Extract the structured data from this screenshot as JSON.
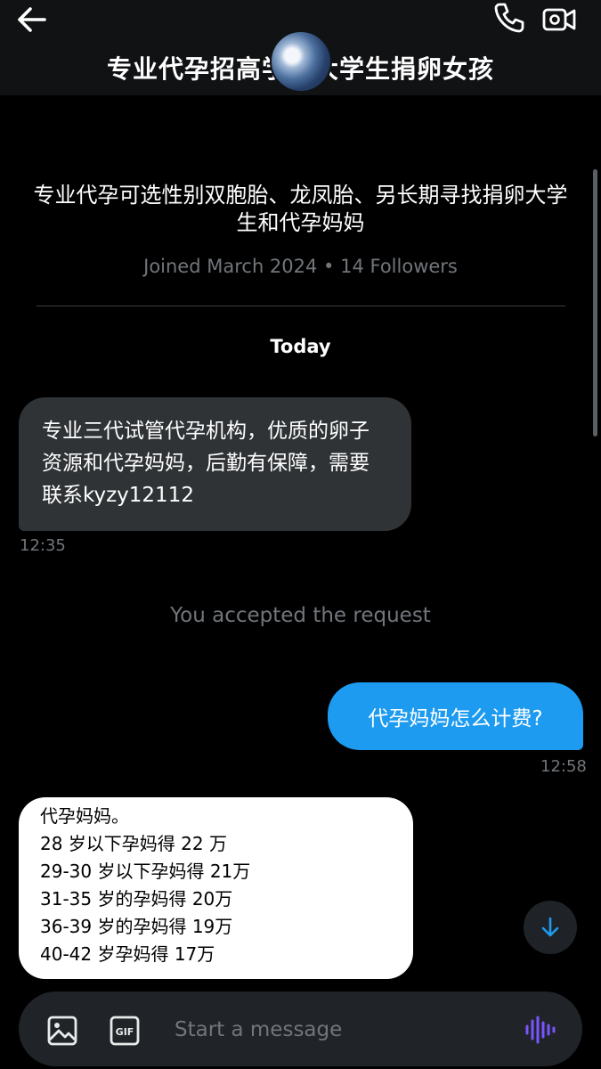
{
  "header": {
    "title": "专业代孕招高学历大学生捐卵女孩"
  },
  "profile": {
    "bio": "专业代孕可选性别双胞胎、龙凤胎、另长期寻找捐卵大学生和代孕妈妈",
    "meta": "Joined March 2024 • 14 Followers"
  },
  "conversation": {
    "day_label": "Today",
    "messages": [
      {
        "text": "专业三代试管代孕机构，优质的卵子资源和代孕妈妈，后勤有保障，需要联系kyzy12112",
        "time": "12:35"
      },
      {
        "system": "You accepted the request"
      },
      {
        "text": "代孕妈妈怎么计费?",
        "time": "12:58"
      }
    ],
    "image_message": {
      "lines": [
        "代孕妈妈。",
        "28 岁以下孕妈得 22 万",
        "29-30 岁以下孕妈得 21万",
        "31-35 岁的孕妈得 20万",
        "36-39 岁的孕妈得 19万",
        "40-42 岁孕妈得 17万"
      ]
    }
  },
  "composer": {
    "placeholder": "Start a message",
    "gif_label": "GIF"
  },
  "colors": {
    "accent": "#1d9bf0",
    "incoming_bubble": "#2f3336",
    "muted_text": "#71767b",
    "voice_icon": "#7856ff"
  },
  "icons": [
    "back-arrow-icon",
    "phone-icon",
    "video-camera-icon",
    "arrow-down-icon",
    "image-icon",
    "gif-icon",
    "voice-wave-icon"
  ]
}
